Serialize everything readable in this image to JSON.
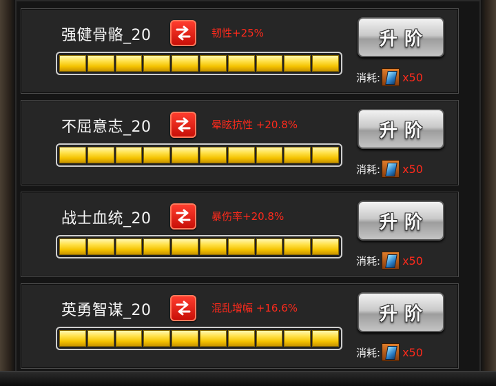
{
  "panels": [
    {
      "name": "强健骨骼_20",
      "stat": "韧性+25%",
      "upgrade_label": "升阶",
      "cost_label": "消耗:",
      "cost_qty": "x50",
      "cost_item_icon": "skill-book-icon",
      "progress_segments": 10,
      "progress_filled": 10
    },
    {
      "name": "不屈意志_20",
      "stat": "晕眩抗性 +20.8%",
      "upgrade_label": "升阶",
      "cost_label": "消耗:",
      "cost_qty": "x50",
      "cost_item_icon": "skill-book-icon",
      "progress_segments": 10,
      "progress_filled": 10
    },
    {
      "name": "战士血统_20",
      "stat": "暴伤率+20.8%",
      "upgrade_label": "升阶",
      "cost_label": "消耗:",
      "cost_qty": "x50",
      "cost_item_icon": "skill-book-icon",
      "progress_segments": 10,
      "progress_filled": 10
    },
    {
      "name": "英勇智谋_20",
      "stat": "混乱增幅 +16.6%",
      "upgrade_label": "升阶",
      "cost_label": "消耗:",
      "cost_qty": "x50",
      "cost_item_icon": "skill-book-icon",
      "progress_segments": 10,
      "progress_filled": 10
    }
  ],
  "colors": {
    "stat_text": "#ff2a1c",
    "progress_fill": "#f4c200",
    "swap_button": "#e0200f"
  }
}
